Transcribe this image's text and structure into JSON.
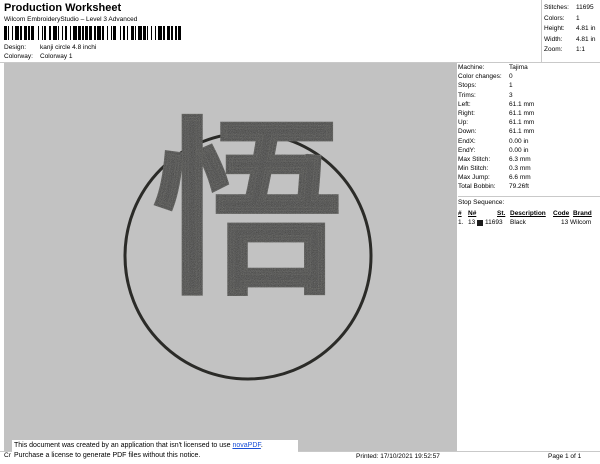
{
  "header": {
    "title": "Production Worksheet",
    "software": "Wilcom EmbroideryStudio – Level 3 Advanced",
    "design_label": "Design:",
    "design_value": "kanji circle 4.8 inchi",
    "colorway_label": "Colorway:",
    "colorway_value": "Colorway 1"
  },
  "stats": [
    {
      "label": "Stitches:",
      "value": "11695"
    },
    {
      "label": "Colors:",
      "value": "1"
    },
    {
      "label": "Height:",
      "value": "4.81 in"
    },
    {
      "label": "Width:",
      "value": "4.81 in"
    },
    {
      "label": "Zoom:",
      "value": "1:1"
    }
  ],
  "machine": [
    {
      "label": "Machine:",
      "value": "Tajima"
    },
    {
      "label": "Color changes:",
      "value": "0"
    },
    {
      "label": "Stops:",
      "value": "1"
    },
    {
      "label": "Trims:",
      "value": "3"
    },
    {
      "label": "Left:",
      "value": "61.1 mm"
    },
    {
      "label": "Right:",
      "value": "61.1 mm"
    },
    {
      "label": "Up:",
      "value": "61.1 mm"
    },
    {
      "label": "Down:",
      "value": "61.1 mm"
    },
    {
      "label": "EndX:",
      "value": "0.00 in"
    },
    {
      "label": "EndY:",
      "value": "0.00 in"
    },
    {
      "label": "Max Stitch:",
      "value": "6.3 mm"
    },
    {
      "label": "Min Stitch:",
      "value": "0.3 mm"
    },
    {
      "label": "Max Jump:",
      "value": "6.6 mm"
    },
    {
      "label": "Total Bobbin:",
      "value": "79.26ft"
    }
  ],
  "stop_sequence": {
    "title": "Stop Sequence:",
    "columns": [
      "#",
      "N#",
      "St.",
      "Description",
      "Code",
      "Brand"
    ],
    "rows": [
      {
        "index": "1.",
        "needle": "13",
        "stitches": "11693",
        "description": "Black",
        "code": "13",
        "brand": "Wilcom",
        "color": "#1a1a1a"
      }
    ]
  },
  "design": {
    "glyph": "悟",
    "thread_color": "#2b2b28",
    "background": "#c2c2c2"
  },
  "notice": {
    "line1_prefix": "This document was created by an application that isn't licensed to use ",
    "link_text": "novaPDF",
    "line1_suffix": ".",
    "line2": "Purchase a license to generate PDF files without this notice.",
    "partial": "Cr"
  },
  "footer": {
    "printed": "Printed: 17/10/2021 19:52:57",
    "page": "Page 1 of 1"
  }
}
